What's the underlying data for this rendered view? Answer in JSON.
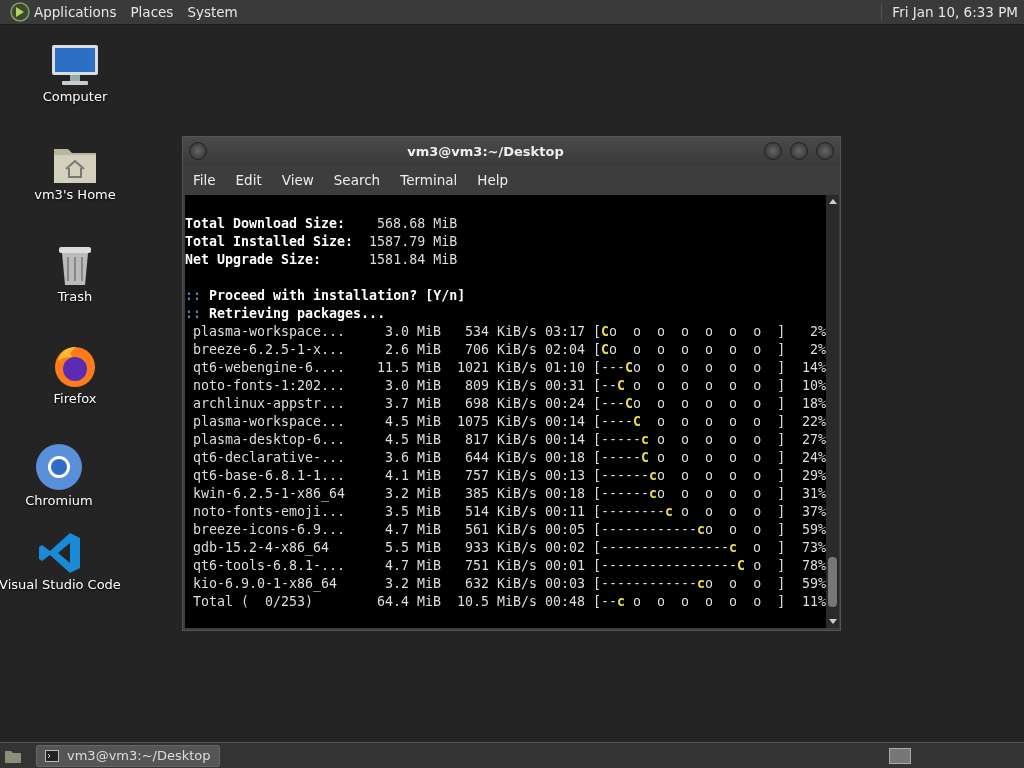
{
  "top_panel": {
    "menus": [
      "Applications",
      "Places",
      "System"
    ],
    "clock": "Fri Jan 10,  6:33 PM"
  },
  "desktop_icons": [
    {
      "kind": "computer",
      "label": "Computer"
    },
    {
      "kind": "home",
      "label": "vm3's Home"
    },
    {
      "kind": "trash",
      "label": "Trash"
    },
    {
      "kind": "firefox",
      "label": "Firefox"
    },
    {
      "kind": "chromium",
      "label": "Chromium"
    },
    {
      "kind": "vscode",
      "label": "Visual Studio Code"
    }
  ],
  "terminal": {
    "title": "vm3@vm3:~/Desktop",
    "menu": [
      "File",
      "Edit",
      "View",
      "Search",
      "Terminal",
      "Help"
    ],
    "summary": [
      {
        "label": "Total Download Size:",
        "value": "568.68 MiB"
      },
      {
        "label": "Total Installed Size:",
        "value": "1587.79 MiB"
      },
      {
        "label": "Net Upgrade Size:",
        "value": "1581.84 MiB"
      }
    ],
    "prompts": [
      {
        "marker": "::",
        "text": "Proceed with installation? [Y/n]"
      },
      {
        "marker": "::",
        "text": "Retrieving packages..."
      }
    ],
    "downloads": [
      {
        "name": "plasma-workspace...",
        "size": "3.0 MiB",
        "speed": "534 KiB/s",
        "eta": "03:17",
        "bar_before": "[",
        "pacman": "C",
        "bar_after": "o  o  o  o  o  o  o  ]",
        "percent": "2%"
      },
      {
        "name": "breeze-6.2.5-1-x...",
        "size": "2.6 MiB",
        "speed": "706 KiB/s",
        "eta": "02:04",
        "bar_before": "[",
        "pacman": "C",
        "bar_after": "o  o  o  o  o  o  o  ]",
        "percent": "2%"
      },
      {
        "name": "qt6-webengine-6....",
        "size": "11.5 MiB",
        "speed": "1021 KiB/s",
        "eta": "01:10",
        "bar_before": "[---",
        "pacman": "C",
        "bar_after": "o  o  o  o  o  o  ]",
        "percent": "14%"
      },
      {
        "name": "noto-fonts-1:202...",
        "size": "3.0 MiB",
        "speed": "809 KiB/s",
        "eta": "00:31",
        "bar_before": "[--",
        "pacman": "C",
        "bar_after": " o  o  o  o  o  o  ]",
        "percent": "10%"
      },
      {
        "name": "archlinux-appstr...",
        "size": "3.7 MiB",
        "speed": "698 KiB/s",
        "eta": "00:24",
        "bar_before": "[---",
        "pacman": "C",
        "bar_after": "o  o  o  o  o  o  ]",
        "percent": "18%"
      },
      {
        "name": "plasma-workspace...",
        "size": "4.5 MiB",
        "speed": "1075 KiB/s",
        "eta": "00:14",
        "bar_before": "[----",
        "pacman": "C",
        "bar_after": "  o  o  o  o  o  ]",
        "percent": "22%"
      },
      {
        "name": "plasma-desktop-6...",
        "size": "4.5 MiB",
        "speed": "817 KiB/s",
        "eta": "00:14",
        "bar_before": "[-----",
        "pacman": "c",
        "bar_after": " o  o  o  o  o  ]",
        "percent": "27%"
      },
      {
        "name": "qt6-declarative-...",
        "size": "3.6 MiB",
        "speed": "644 KiB/s",
        "eta": "00:18",
        "bar_before": "[-----",
        "pacman": "C",
        "bar_after": " o  o  o  o  o  ]",
        "percent": "24%"
      },
      {
        "name": "qt6-base-6.8.1-1...",
        "size": "4.1 MiB",
        "speed": "757 KiB/s",
        "eta": "00:13",
        "bar_before": "[------",
        "pacman": "c",
        "bar_after": "o  o  o  o  o  ]",
        "percent": "29%"
      },
      {
        "name": "kwin-6.2.5-1-x86_64",
        "size": "3.2 MiB",
        "speed": "385 KiB/s",
        "eta": "00:18",
        "bar_before": "[------",
        "pacman": "c",
        "bar_after": "o  o  o  o  o  ]",
        "percent": "31%"
      },
      {
        "name": "noto-fonts-emoji...",
        "size": "3.5 MiB",
        "speed": "514 KiB/s",
        "eta": "00:11",
        "bar_before": "[--------",
        "pacman": "c",
        "bar_after": " o  o  o  o  ]",
        "percent": "37%"
      },
      {
        "name": "breeze-icons-6.9...",
        "size": "4.7 MiB",
        "speed": "561 KiB/s",
        "eta": "00:05",
        "bar_before": "[------------",
        "pacman": "c",
        "bar_after": "o  o  o  ]",
        "percent": "59%"
      },
      {
        "name": "gdb-15.2-4-x86_64",
        "size": "5.5 MiB",
        "speed": "933 KiB/s",
        "eta": "00:02",
        "bar_before": "[----------------",
        "pacman": "c",
        "bar_after": "  o  ]",
        "percent": "73%"
      },
      {
        "name": "qt6-tools-6.8.1-...",
        "size": "4.7 MiB",
        "speed": "751 KiB/s",
        "eta": "00:01",
        "bar_before": "[-----------------",
        "pacman": "C",
        "bar_after": " o  ]",
        "percent": "78%"
      },
      {
        "name": "kio-6.9.0-1-x86_64",
        "size": "3.2 MiB",
        "speed": "632 KiB/s",
        "eta": "00:03",
        "bar_before": "[------------",
        "pacman": "c",
        "bar_after": "o  o  o  ]",
        "percent": "59%"
      },
      {
        "name": "Total (  0/253)",
        "size": "64.4 MiB",
        "speed": "10.5 MiB/s",
        "eta": "00:48",
        "bar_before": "[--",
        "pacman": "c",
        "bar_after": " o  o  o  o  o  o  ]",
        "percent": "11%"
      }
    ]
  },
  "taskbar": {
    "windows": [
      {
        "title": "vm3@vm3:~/Desktop",
        "selected": true
      }
    ]
  }
}
